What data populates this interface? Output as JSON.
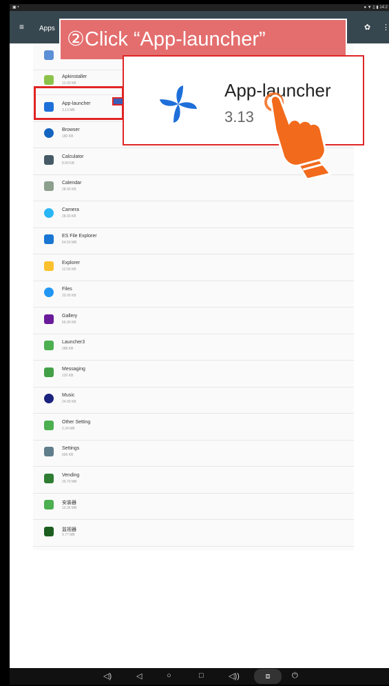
{
  "status_bar": {
    "left_icons": "▣ •",
    "right_icons": "● ▼ ▯ ▮ 14:2"
  },
  "app_bar": {
    "menu_icon": "≡",
    "title": "Apps",
    "gear_icon": "✿",
    "more_icon": "⋮"
  },
  "callout": {
    "banner_text": "②Click “App-launcher”",
    "zoom_name": "App-launcher",
    "zoom_size": "3.13"
  },
  "apps": [
    {
      "name": "",
      "size": "",
      "icon": "android-box-icon",
      "color": "#5c8fd6"
    },
    {
      "name": "Apkinstaller",
      "size": "12.00 KB",
      "icon": "android-icon",
      "color": "#8bc34a"
    },
    {
      "name": "App-launcher",
      "size": "3.13 MB",
      "icon": "pinwheel-icon",
      "color": "#1e6fd9"
    },
    {
      "name": "Browser",
      "size": "180 KB",
      "icon": "globe-icon",
      "color": "#1565c0"
    },
    {
      "name": "Calculator",
      "size": "8.00 KB",
      "icon": "calculator-icon",
      "color": "#455a64"
    },
    {
      "name": "Calendar",
      "size": "28.00 KB",
      "icon": "calendar-icon",
      "color": "#8d9f8d"
    },
    {
      "name": "Camera",
      "size": "28.00 KB",
      "icon": "camera-icon",
      "color": "#29b6f6"
    },
    {
      "name": "ES File Explorer",
      "size": "64.53 MB",
      "icon": "cloud-folder-icon",
      "color": "#1976d2"
    },
    {
      "name": "Explorer",
      "size": "12.00 KB",
      "icon": "folder-icon",
      "color": "#fbc02d"
    },
    {
      "name": "Files",
      "size": "20.00 KB",
      "icon": "files-icon",
      "color": "#2196f3"
    },
    {
      "name": "Gallery",
      "size": "56.00 KB",
      "icon": "gallery-icon",
      "color": "#6a1b9a"
    },
    {
      "name": "Launcher3",
      "size": "288 KB",
      "icon": "home-icon",
      "color": "#4caf50"
    },
    {
      "name": "Messaging",
      "size": "120 KB",
      "icon": "message-icon",
      "color": "#43a047"
    },
    {
      "name": "Music",
      "size": "24.00 KB",
      "icon": "music-icon",
      "color": "#1a237e"
    },
    {
      "name": "Other Setting",
      "size": "2.34 MB",
      "icon": "android-box-icon",
      "color": "#4caf50"
    },
    {
      "name": "Settings",
      "size": "696 KB",
      "icon": "gear-icon",
      "color": "#607d8b"
    },
    {
      "name": "Vending",
      "size": "29.70 MB",
      "icon": "android-box-icon",
      "color": "#2e7d32"
    },
    {
      "name": "安装器",
      "size": "10.36 MB",
      "icon": "android-box-icon",
      "color": "#4caf50"
    },
    {
      "name": "监视器",
      "size": "9.77 MB",
      "icon": "android-box-icon",
      "color": "#1b5e20"
    }
  ],
  "nav_bar": {
    "volume_down_icon": "◁)",
    "back_icon": "◁",
    "home_icon": "○",
    "recents_icon": "□",
    "volume_up_icon": "◁))",
    "screenshot_icon": "⧈",
    "power_icon": "⏻"
  }
}
